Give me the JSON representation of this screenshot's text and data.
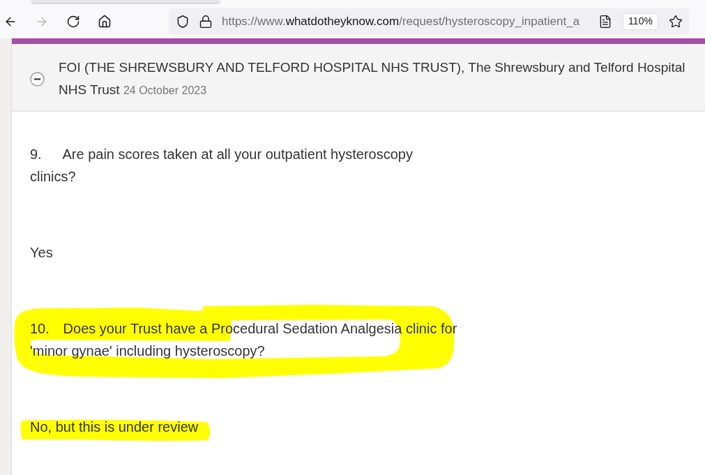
{
  "browser": {
    "forward_disabled": true,
    "url": {
      "scheme": "https://www.",
      "domain": "whatdotheyknow.com",
      "path": "/request/hysteroscopy_inpatient_a"
    },
    "zoom": "110%"
  },
  "message": {
    "expanded": true,
    "sender": "FOI (THE SHREWSBURY AND TELFORD HOSPITAL NHS TRUST), The Shrewsbury and Telford Hospital NHS Trust",
    "date": "24 October 2023"
  },
  "paragraphs": [
    {
      "number": "9.",
      "text": "Are pain scores taken at all your outpatient hysteroscopy clinics?",
      "circled": false,
      "highlighted": false
    },
    {
      "text": "Yes",
      "circled": false,
      "highlighted": false
    },
    {
      "number": "10.",
      "text": "Does your Trust have a Procedural Sedation Analgesia clinic for 'minor gynae' including hysteroscopy?",
      "circled": true,
      "highlighted": false
    },
    {
      "text": "No, but this is under review",
      "circled": false,
      "highlighted": true
    }
  ]
}
